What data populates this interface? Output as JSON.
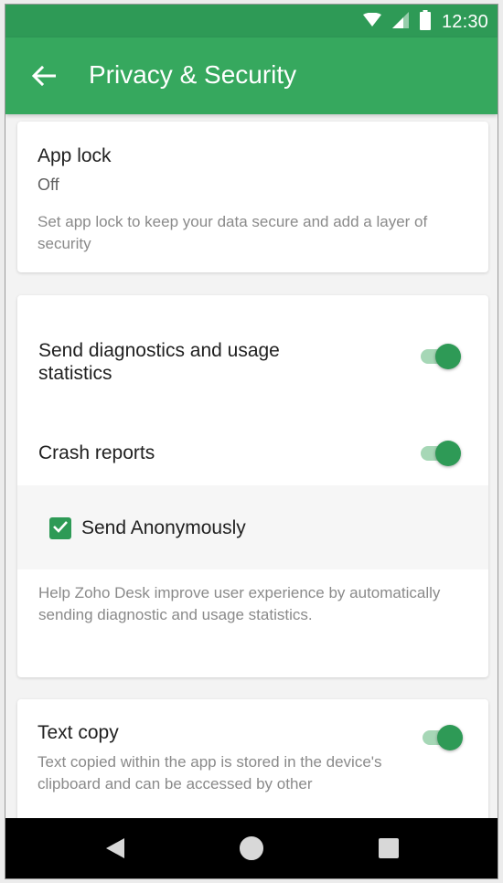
{
  "status_bar": {
    "time": "12:30"
  },
  "app_bar": {
    "title": "Privacy & Security"
  },
  "app_lock": {
    "title": "App lock",
    "value": "Off",
    "description": "Set app lock to keep your data secure and add a layer of security"
  },
  "diagnostics": {
    "send_stats_label": "Send diagnostics and usage statistics",
    "send_stats_enabled": true,
    "crash_reports_label": "Crash reports",
    "crash_reports_enabled": true,
    "send_anonymously_label": "Send Anonymously",
    "send_anonymously_checked": true,
    "description": "Help Zoho Desk improve user experience by automatically sending diagnostic and usage statistics."
  },
  "text_copy": {
    "title": "Text copy",
    "enabled": true,
    "description": "Text copied within the app is stored in the device's clipboard and can be accessed by other"
  },
  "colors": {
    "primary": "#36a85e",
    "status_bar": "#2e9a56",
    "accent": "#2e9a56"
  },
  "icons": [
    "wifi-icon",
    "signal-icon",
    "battery-icon",
    "back-arrow-icon",
    "nav-back-icon",
    "nav-home-icon",
    "nav-recents-icon",
    "checkmark-icon"
  ]
}
